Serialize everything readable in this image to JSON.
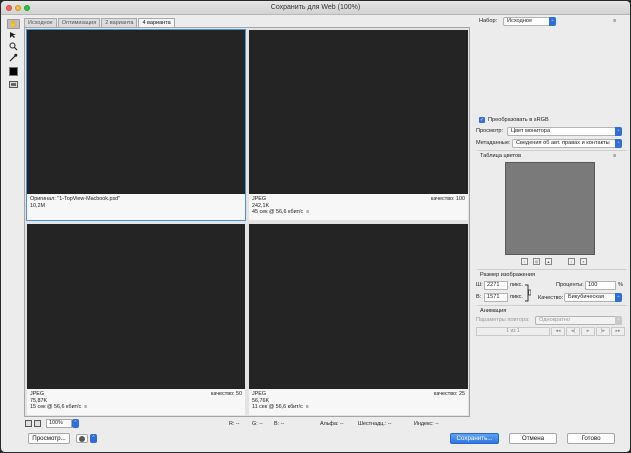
{
  "window": {
    "title": "Сохранить для Web (100%)",
    "traffic_colors": [
      "#fd5f57",
      "#fdbc2e",
      "#28c840"
    ]
  },
  "tools": [
    "hand-tool",
    "slice-select-tool",
    "zoom-tool",
    "eyedropper-tool"
  ],
  "tabs": [
    "Исходное",
    "Оптимизация",
    "2 варианта",
    "4 варианта"
  ],
  "panes": [
    {
      "line1": "Оригинал: \"1-TopView-Macbook.psd\"",
      "line2": "10,2M",
      "line3": "",
      "quality": ""
    },
    {
      "line1": "JPEG",
      "line2": "242,1K",
      "line3": "45 сек @ 56,6 кбит/с",
      "quality": "качество: 100"
    },
    {
      "line1": "JPEG",
      "line2": "75,87K",
      "line3": "15 сек @ 56,6 кбит/с",
      "quality": "качество: 50"
    },
    {
      "line1": "JPEG",
      "line2": "56,76K",
      "line3": "11 сек @ 56,6 кбит/с",
      "quality": "качество: 25"
    }
  ],
  "pane_menu_icon": "≡",
  "status": {
    "zoom": "100%",
    "r": "R: --",
    "g": "G: --",
    "b": "B: --",
    "alpha": "Альфа: --",
    "hex": "Шестнадц.: --",
    "index": "Индекс: --"
  },
  "bottom": {
    "preview_btn": "Просмотр...",
    "save_btn": "Сохранить...",
    "cancel_btn": "Отмена",
    "done_btn": "Готово"
  },
  "settings": {
    "preset_label": "Набор:",
    "preset_value": "Исходное",
    "convert_srgb": "Преобразовать в sRGB",
    "preview_label": "Просмотр:",
    "preview_value": "Цвет монитора",
    "metadata_label": "Метаданные:",
    "metadata_value": "Сведения об авт. правах и контакты",
    "color_table_label": "Таблица цветов",
    "image_size_label": "Размер изображения",
    "w_label": "Ш:",
    "w_value": "2271",
    "h_label": "В:",
    "h_value": "1571",
    "px": "пикс.",
    "percent_label": "Проценты:",
    "percent_value": "100",
    "percent_sign": "%",
    "quality_label": "Качество:",
    "quality_value": "Бикубическая",
    "animation_label": "Анимация",
    "loop_label": "Параметры повтора:",
    "loop_value": "Однократно",
    "frame_counter": "1 из 1"
  },
  "colors": {
    "accent": "#2f6fd8",
    "selected_outline": "#4a90e2",
    "preview_bg": "#242424",
    "color_table_bg": "#7a7a7a"
  }
}
